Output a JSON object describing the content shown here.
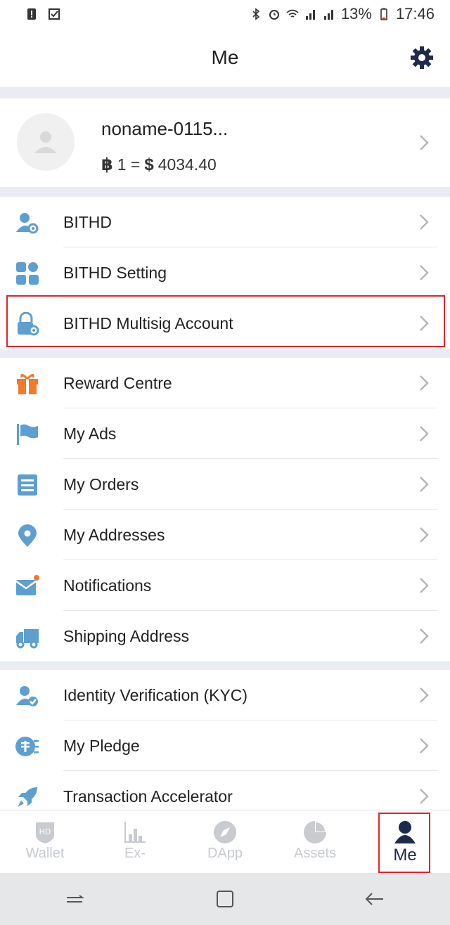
{
  "status_bar": {
    "battery": "13%",
    "time": "17:46",
    "left_icons": [
      "alert-icon",
      "checkbox-icon"
    ],
    "right_icons": [
      "bluetooth-icon",
      "alarm-icon",
      "wifi-icon",
      "signal-4g-icon",
      "signal-3g-icon",
      "battery-icon"
    ]
  },
  "header": {
    "title": "Me"
  },
  "profile": {
    "name": "noname-0115...",
    "rate": "1 =",
    "rate_value": "4034.40",
    "btc_symbol": "฿",
    "usd_symbol": "$"
  },
  "groups": [
    {
      "items": [
        {
          "label": "BITHD",
          "icon": "user-gear-icon"
        },
        {
          "label": "BITHD Setting",
          "icon": "grid-apps-icon"
        },
        {
          "label": "BITHD Multisig Account",
          "icon": "lock-gear-icon"
        }
      ]
    },
    {
      "items": [
        {
          "label": "Reward Centre",
          "icon": "gift-icon"
        },
        {
          "label": "My Ads",
          "icon": "flag-icon"
        },
        {
          "label": "My Orders",
          "icon": "list-doc-icon"
        },
        {
          "label": "My Addresses",
          "icon": "map-pin-icon"
        },
        {
          "label": "Notifications",
          "icon": "mail-icon"
        },
        {
          "label": "Shipping Address",
          "icon": "truck-icon"
        }
      ]
    },
    {
      "items": [
        {
          "label": "Identity Verification (KYC)",
          "icon": "user-check-icon"
        },
        {
          "label": "My Pledge",
          "icon": "pledge-icon"
        },
        {
          "label": "Transaction Accelerator",
          "icon": "rocket-icon"
        }
      ]
    }
  ],
  "tabs": [
    {
      "label": "Wallet",
      "icon": "wallet-hd-icon",
      "active": false
    },
    {
      "label": "Ex-",
      "icon": "exchange-chart-icon",
      "active": false
    },
    {
      "label": "DApp",
      "icon": "compass-icon",
      "active": false
    },
    {
      "label": "Assets",
      "icon": "pie-chart-icon",
      "active": false
    },
    {
      "label": "Me",
      "icon": "person-icon",
      "active": true
    }
  ],
  "colors": {
    "accent": "#1e2a4a",
    "icon_blue": "#5e9fd1",
    "icon_orange": "#f07b2a",
    "highlight": "#e0232f",
    "gap": "#e9edf3"
  }
}
